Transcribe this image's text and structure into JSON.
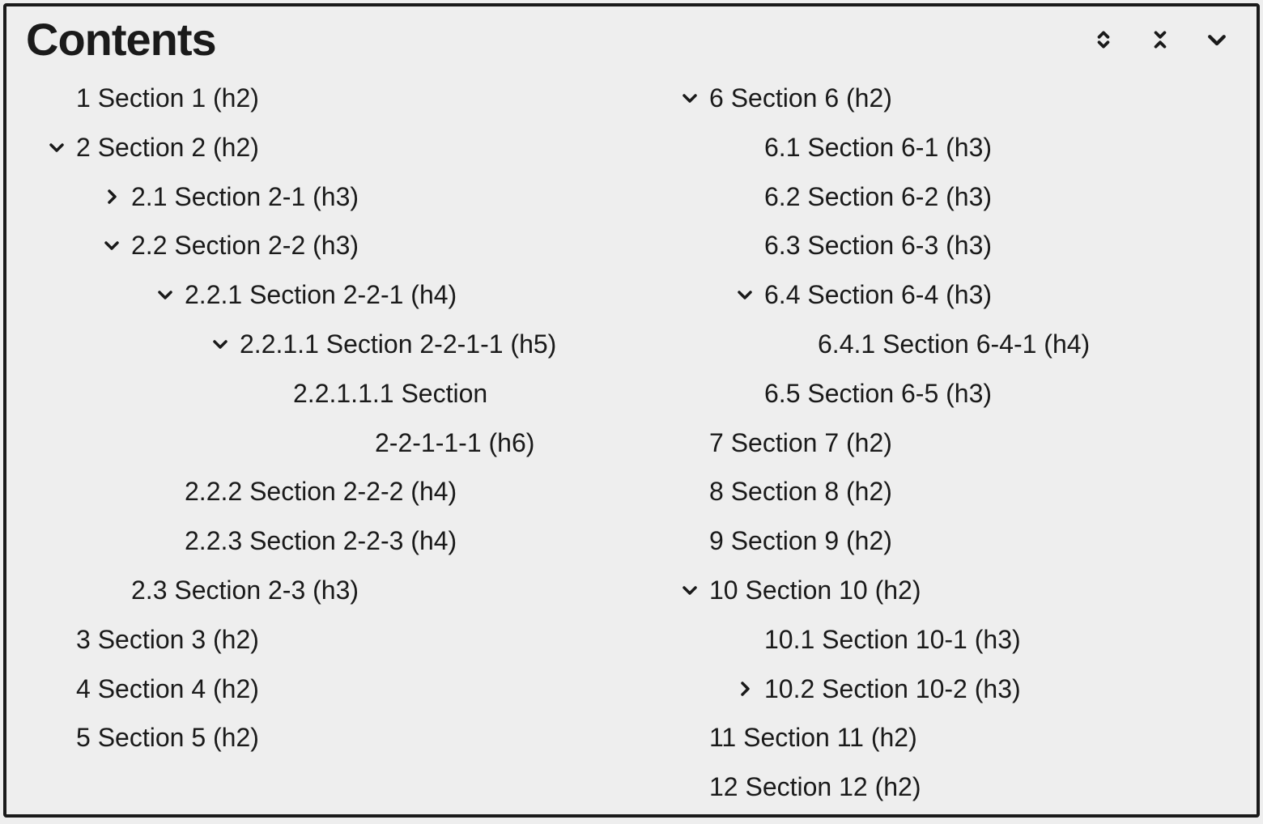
{
  "title": "Contents",
  "col1": [
    {
      "level": 1,
      "caret": "none",
      "text": "1 Section 1 (h2)"
    },
    {
      "level": 1,
      "caret": "down",
      "text": "2 Section 2 (h2)"
    },
    {
      "level": 2,
      "caret": "right",
      "text": "2.1 Section 2-1 (h3)"
    },
    {
      "level": 2,
      "caret": "down",
      "text": "2.2 Section 2-2 (h3)"
    },
    {
      "level": 3,
      "caret": "down",
      "text": "2.2.1 Section 2-2-1 (h4)"
    },
    {
      "level": 4,
      "caret": "down",
      "text": "2.2.1.1 Section 2-2-1-1 (h5)"
    },
    {
      "level": 5,
      "caret": "none",
      "text": "2.2.1.1.1 Section"
    },
    {
      "level": 5,
      "caret": "cont",
      "text": "2-2-1-1-1 (h6)"
    },
    {
      "level": 3,
      "caret": "none",
      "text": "2.2.2 Section 2-2-2 (h4)"
    },
    {
      "level": 3,
      "caret": "none",
      "text": "2.2.3 Section 2-2-3 (h4)"
    },
    {
      "level": 2,
      "caret": "none",
      "text": "2.3 Section 2-3 (h3)"
    },
    {
      "level": 1,
      "caret": "none",
      "text": "3 Section 3 (h2)"
    },
    {
      "level": 1,
      "caret": "none",
      "text": "4 Section 4 (h2)"
    },
    {
      "level": 1,
      "caret": "none",
      "text": "5 Section 5 (h2)"
    }
  ],
  "col2": [
    {
      "level": 1,
      "caret": "down",
      "text": "6 Section 6 (h2)"
    },
    {
      "level": 2,
      "caret": "none",
      "text": "6.1 Section 6-1 (h3)"
    },
    {
      "level": 2,
      "caret": "none",
      "text": "6.2 Section 6-2 (h3)"
    },
    {
      "level": 2,
      "caret": "none",
      "text": "6.3 Section 6-3 (h3)"
    },
    {
      "level": 2,
      "caret": "down",
      "text": "6.4 Section 6-4 (h3)"
    },
    {
      "level": 3,
      "caret": "none",
      "text": "6.4.1 Section 6-4-1 (h4)"
    },
    {
      "level": 2,
      "caret": "none",
      "text": "6.5 Section 6-5 (h3)"
    },
    {
      "level": 1,
      "caret": "none",
      "text": "7 Section 7 (h2)"
    },
    {
      "level": 1,
      "caret": "none",
      "text": "8 Section 8 (h2)"
    },
    {
      "level": 1,
      "caret": "none",
      "text": "9 Section 9 (h2)"
    },
    {
      "level": 1,
      "caret": "down",
      "text": "10 Section 10 (h2)"
    },
    {
      "level": 2,
      "caret": "none",
      "text": "10.1 Section 10-1 (h3)"
    },
    {
      "level": 2,
      "caret": "right",
      "text": "10.2 Section 10-2 (h3)"
    },
    {
      "level": 1,
      "caret": "none",
      "text": "11 Section 11 (h2)"
    },
    {
      "level": 1,
      "caret": "none",
      "text": "12 Section 12 (h2)"
    }
  ]
}
